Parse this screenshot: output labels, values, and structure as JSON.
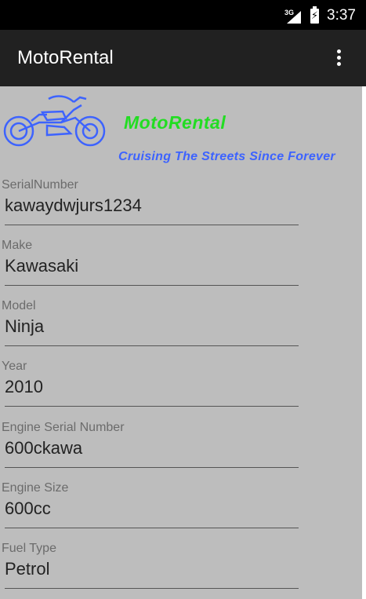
{
  "status_bar": {
    "network": "3G",
    "time": "3:37",
    "battery_icon": "battery-charging-icon",
    "signal_icon": "signal-icon"
  },
  "app_bar": {
    "title": "MotoRental",
    "menu_icon": "overflow-menu-icon"
  },
  "banner": {
    "title": "MotoRental",
    "tagline": "Cruising The Streets Since Forever",
    "title_color": "#22dd22",
    "tagline_color": "#3d63ff",
    "logo_icon": "motorcycle-icon"
  },
  "fields": [
    {
      "label": "SerialNumber",
      "value": "kawaydwjurs1234"
    },
    {
      "label": "Make",
      "value": "Kawasaki"
    },
    {
      "label": "Model",
      "value": "Ninja"
    },
    {
      "label": "Year",
      "value": "2010"
    },
    {
      "label": "Engine Serial Number",
      "value": "600ckawa"
    },
    {
      "label": "Engine Size",
      "value": "600cc"
    },
    {
      "label": "Fuel Type",
      "value": "Petrol"
    }
  ],
  "colors": {
    "status_bar": "#000000",
    "app_bar": "#212121",
    "content_background": "#bdbdbd"
  }
}
